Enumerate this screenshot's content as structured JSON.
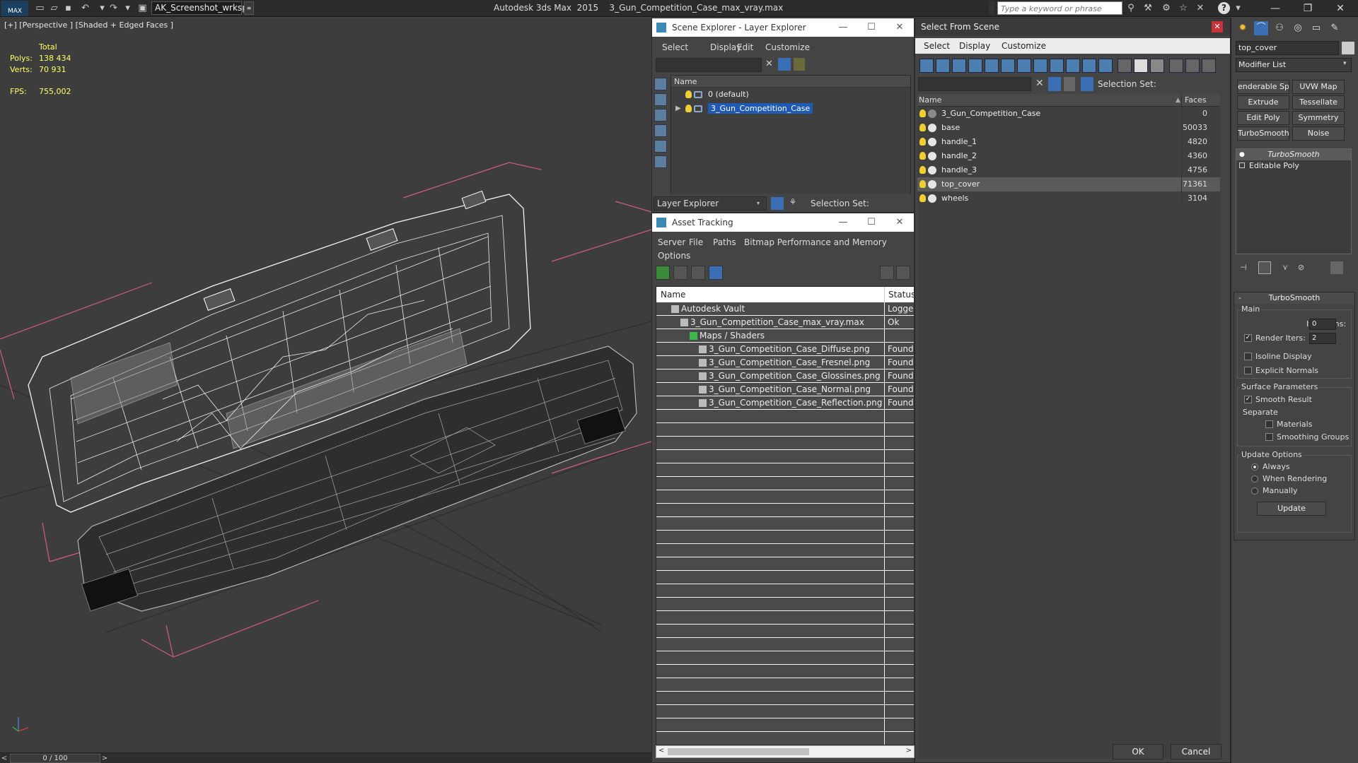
{
  "title_bar": {
    "logo": "MAX",
    "workspace": "AK_Screenshot_wrksp",
    "app_title": "Autodesk 3ds Max  2015    3_Gun_Competition_Case_max_vray.max",
    "search_placeholder": "Type a keyword or phrase"
  },
  "viewport": {
    "label": "[+] [Perspective ] [Shaded + Edged Faces ]",
    "stats": {
      "total_label": "Total",
      "polys_label": "Polys:",
      "polys_value": "138 434",
      "verts_label": "Verts:",
      "verts_value": "70 931",
      "fps_label": "FPS:",
      "fps_value": "755,002"
    },
    "timeline": "0 / 100"
  },
  "scene_explorer": {
    "title": "Scene Explorer - Layer Explorer",
    "menu": [
      "Select",
      "Display",
      "Edit",
      "Customize"
    ],
    "column": "Name",
    "rows": [
      {
        "label": "0 (default)",
        "selected": false
      },
      {
        "label": "3_Gun_Competition_Case",
        "selected": true
      }
    ],
    "footer_dropdown": "Layer Explorer",
    "selection_set_label": "Selection Set:"
  },
  "asset_tracking": {
    "title": "Asset Tracking",
    "menu": [
      "Server",
      "File",
      "Paths",
      "Bitmap Performance and Memory",
      "Options"
    ],
    "columns": [
      "Name",
      "Status"
    ],
    "rows": [
      {
        "name": "Autodesk Vault",
        "status": "Logged",
        "indent": 1
      },
      {
        "name": "3_Gun_Competition_Case_max_vray.max",
        "status": "Ok",
        "indent": 2
      },
      {
        "name": "Maps / Shaders",
        "status": "",
        "indent": 3
      },
      {
        "name": "3_Gun_Competition_Case_Diffuse.png",
        "status": "Found",
        "indent": 4
      },
      {
        "name": "3_Gun_Competition_Case_Fresnel.png",
        "status": "Found",
        "indent": 4
      },
      {
        "name": "3_Gun_Competition_Case_Glossines.png",
        "status": "Found",
        "indent": 4
      },
      {
        "name": "3_Gun_Competition_Case_Normal.png",
        "status": "Found",
        "indent": 4
      },
      {
        "name": "3_Gun_Competition_Case_Reflection.png",
        "status": "Found",
        "indent": 4
      }
    ]
  },
  "select_from_scene": {
    "title": "Select From Scene",
    "menu": [
      "Select",
      "Display",
      "Customize"
    ],
    "selection_set_label": "Selection Set:",
    "columns": [
      "Name",
      "Faces"
    ],
    "rows": [
      {
        "name": "3_Gun_Competition_Case",
        "faces": "0",
        "highlight": false
      },
      {
        "name": "base",
        "faces": "50033",
        "highlight": false
      },
      {
        "name": "handle_1",
        "faces": "4820",
        "highlight": false
      },
      {
        "name": "handle_2",
        "faces": "4360",
        "highlight": false
      },
      {
        "name": "handle_3",
        "faces": "4756",
        "highlight": false
      },
      {
        "name": "top_cover",
        "faces": "71361",
        "highlight": true
      },
      {
        "name": "wheels",
        "faces": "3104",
        "highlight": false
      }
    ],
    "ok": "OK",
    "cancel": "Cancel"
  },
  "command_panel": {
    "object_name": "top_cover",
    "modifier_list": "Modifier List",
    "buttons": [
      "enderable Spli",
      "UVW Map",
      "Extrude",
      "Tessellate",
      "Edit Poly",
      "Symmetry",
      "TurboSmooth",
      "Noise"
    ],
    "stack": [
      "TurboSmooth",
      "Editable Poly"
    ],
    "rollout_title": "TurboSmooth",
    "main_label": "Main",
    "iterations_label": "Iterations:",
    "iterations_value": "0",
    "render_iters_label": "Render Iters:",
    "render_iters_value": "2",
    "isoline": "Isoline Display",
    "explicit_normals": "Explicit Normals",
    "surface_params": "Surface Parameters",
    "smooth_result": "Smooth Result",
    "separate": "Separate",
    "materials": "Materials",
    "smoothing_groups": "Smoothing Groups",
    "update_options": "Update Options",
    "always": "Always",
    "when_rendering": "When Rendering",
    "manually": "Manually",
    "update_button": "Update"
  }
}
